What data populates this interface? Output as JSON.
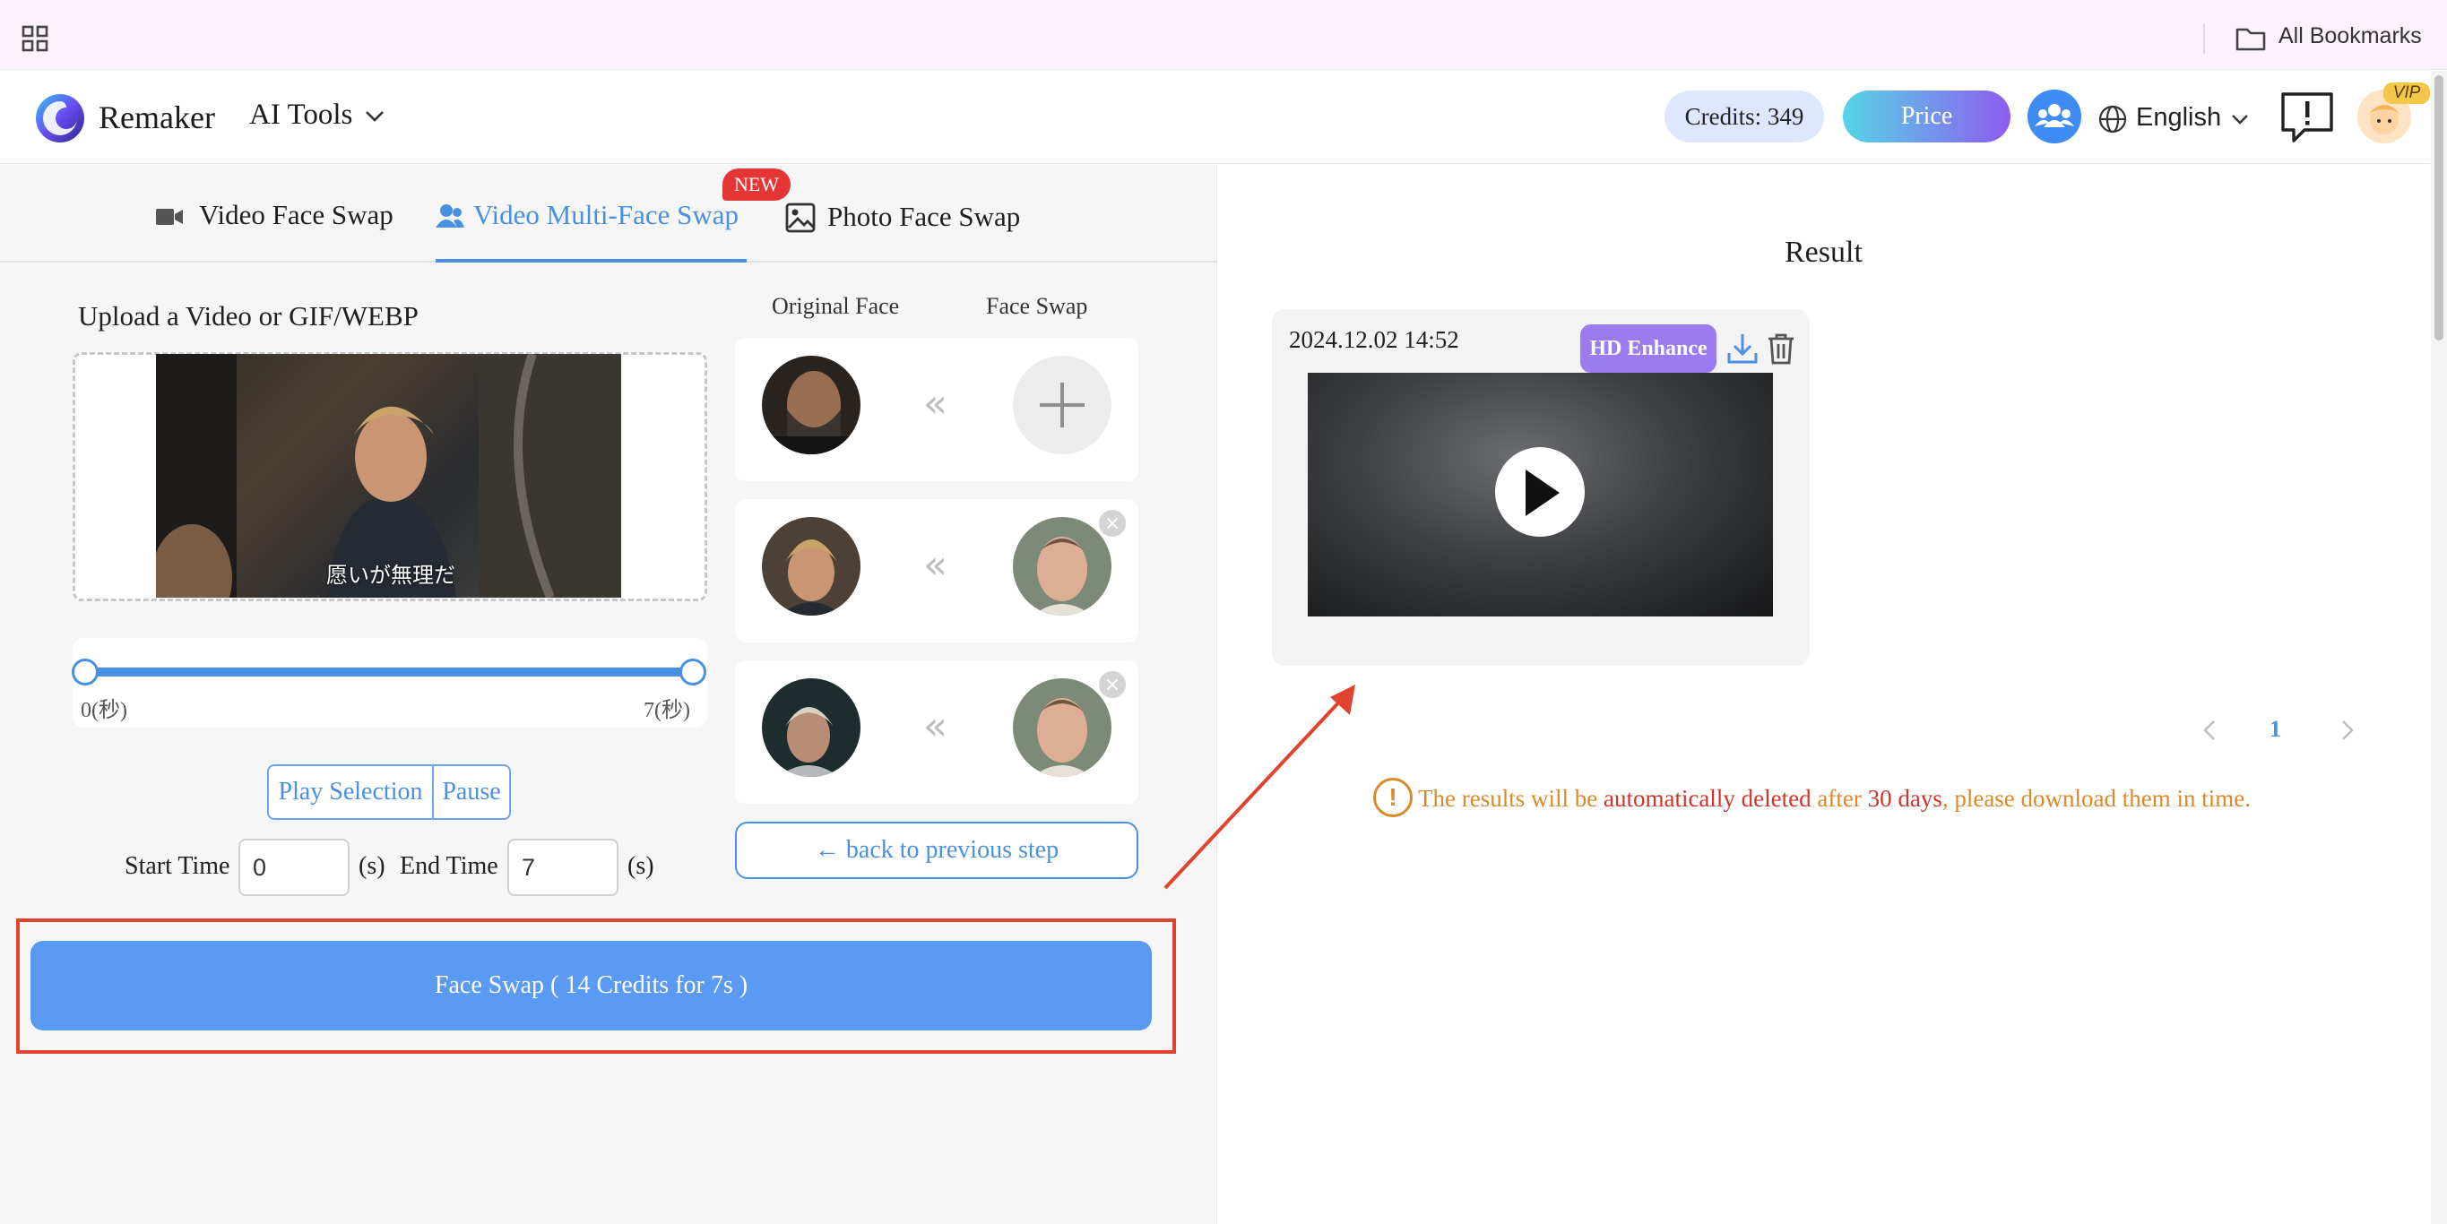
{
  "bookmarks_bar": {
    "all_bookmarks": "All Bookmarks"
  },
  "header": {
    "brand": "Remaker",
    "ai_tools": "AI Tools",
    "credits": "Credits: 349",
    "price": "Price",
    "language": "English",
    "vip_badge": "VIP"
  },
  "tabs": [
    {
      "label": "Video Face Swap",
      "icon": "video-camera-icon",
      "active": false
    },
    {
      "label": "Video Multi-Face Swap",
      "icon": "users-icon",
      "active": true,
      "badge": "NEW"
    },
    {
      "label": "Photo Face Swap",
      "icon": "image-icon",
      "active": false
    }
  ],
  "upload": {
    "title": "Upload a Video or GIF/WEBP",
    "subtitle_text": "愿いが無理だ"
  },
  "slider": {
    "min_label": "0(秒)",
    "max_label": "7(秒)",
    "start_fraction": 0.0,
    "end_fraction": 1.0
  },
  "playback": {
    "play_selection": "Play Selection",
    "pause": "Pause"
  },
  "time": {
    "start_label": "Start Time",
    "start_value": "0",
    "end_label": "End Time",
    "end_value": "7",
    "unit": "(s)"
  },
  "faces": {
    "col_original": "Original Face",
    "col_swap": "Face Swap",
    "pairs": [
      {
        "original": "bald-man-face",
        "swap": "add-face-placeholder",
        "removable": false
      },
      {
        "original": "blond-man-face",
        "swap": "male-face",
        "removable": true
      },
      {
        "original": "young-man-face",
        "swap": "male-face",
        "removable": true
      }
    ],
    "arrow_glyph": "«",
    "remove_glyph": "×"
  },
  "back_button": "← back to previous step",
  "swap_button": "Face Swap ( 14 Credits for 7s )",
  "result": {
    "title": "Result",
    "date": "2024.12.02 14:52",
    "hd_enhance": "HD Enhance"
  },
  "pagination": {
    "current": "1"
  },
  "notice": {
    "part1": "The results will be ",
    "part2": "automatically deleted",
    "part3": " after ",
    "part4": "30 days",
    "part5": ", please download them in time.",
    "icon_glyph": "!"
  },
  "colors": {
    "accent": "#4a90e2",
    "swap_button": "#5a9af3",
    "highlight": "#e0432f",
    "warning": "#d98a2b",
    "danger": "#d0342c",
    "hd_enhance": "#9b7bf0"
  }
}
